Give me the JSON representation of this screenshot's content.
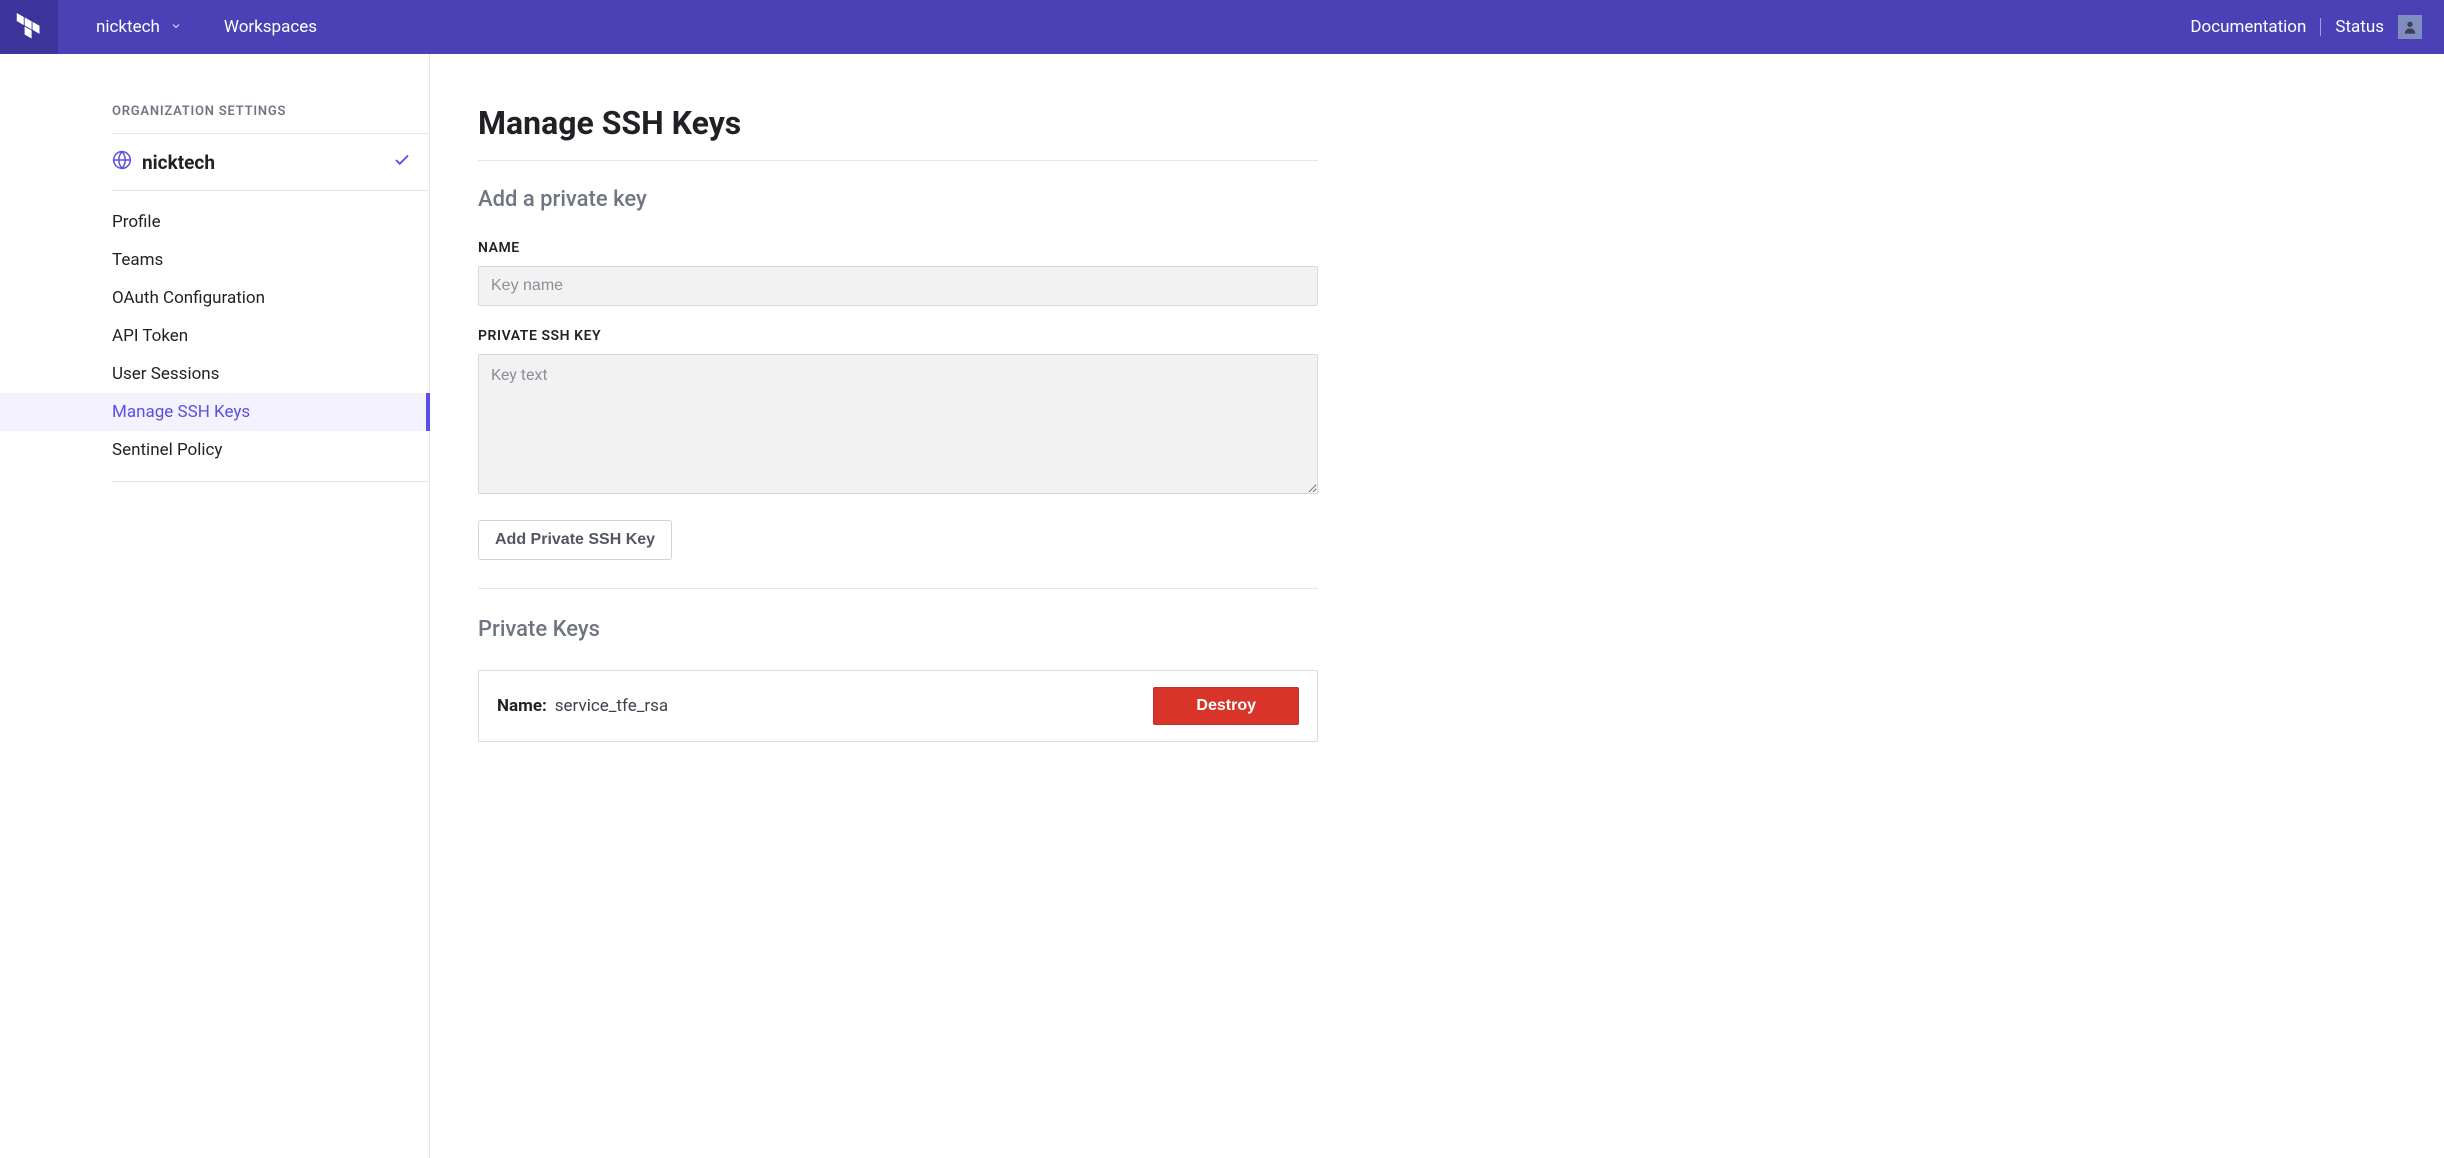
{
  "topbar": {
    "org_name": "nicktech",
    "workspaces_label": "Workspaces",
    "documentation_label": "Documentation",
    "status_label": "Status"
  },
  "sidebar": {
    "heading": "ORGANIZATION SETTINGS",
    "org_name": "nicktech",
    "items": [
      {
        "label": "Profile",
        "active": false
      },
      {
        "label": "Teams",
        "active": false
      },
      {
        "label": "OAuth Configuration",
        "active": false
      },
      {
        "label": "API Token",
        "active": false
      },
      {
        "label": "User Sessions",
        "active": false
      },
      {
        "label": "Manage SSH Keys",
        "active": true
      },
      {
        "label": "Sentinel Policy",
        "active": false
      }
    ]
  },
  "main": {
    "page_title": "Manage SSH Keys",
    "add_section_title": "Add a private key",
    "name_label": "NAME",
    "name_placeholder": "Key name",
    "key_label": "PRIVATE SSH KEY",
    "key_placeholder": "Key text",
    "add_button_label": "Add Private SSH Key",
    "private_keys_title": "Private Keys",
    "keys": [
      {
        "name_label": "Name:",
        "name_value": "service_tfe_rsa",
        "destroy_label": "Destroy"
      }
    ]
  }
}
